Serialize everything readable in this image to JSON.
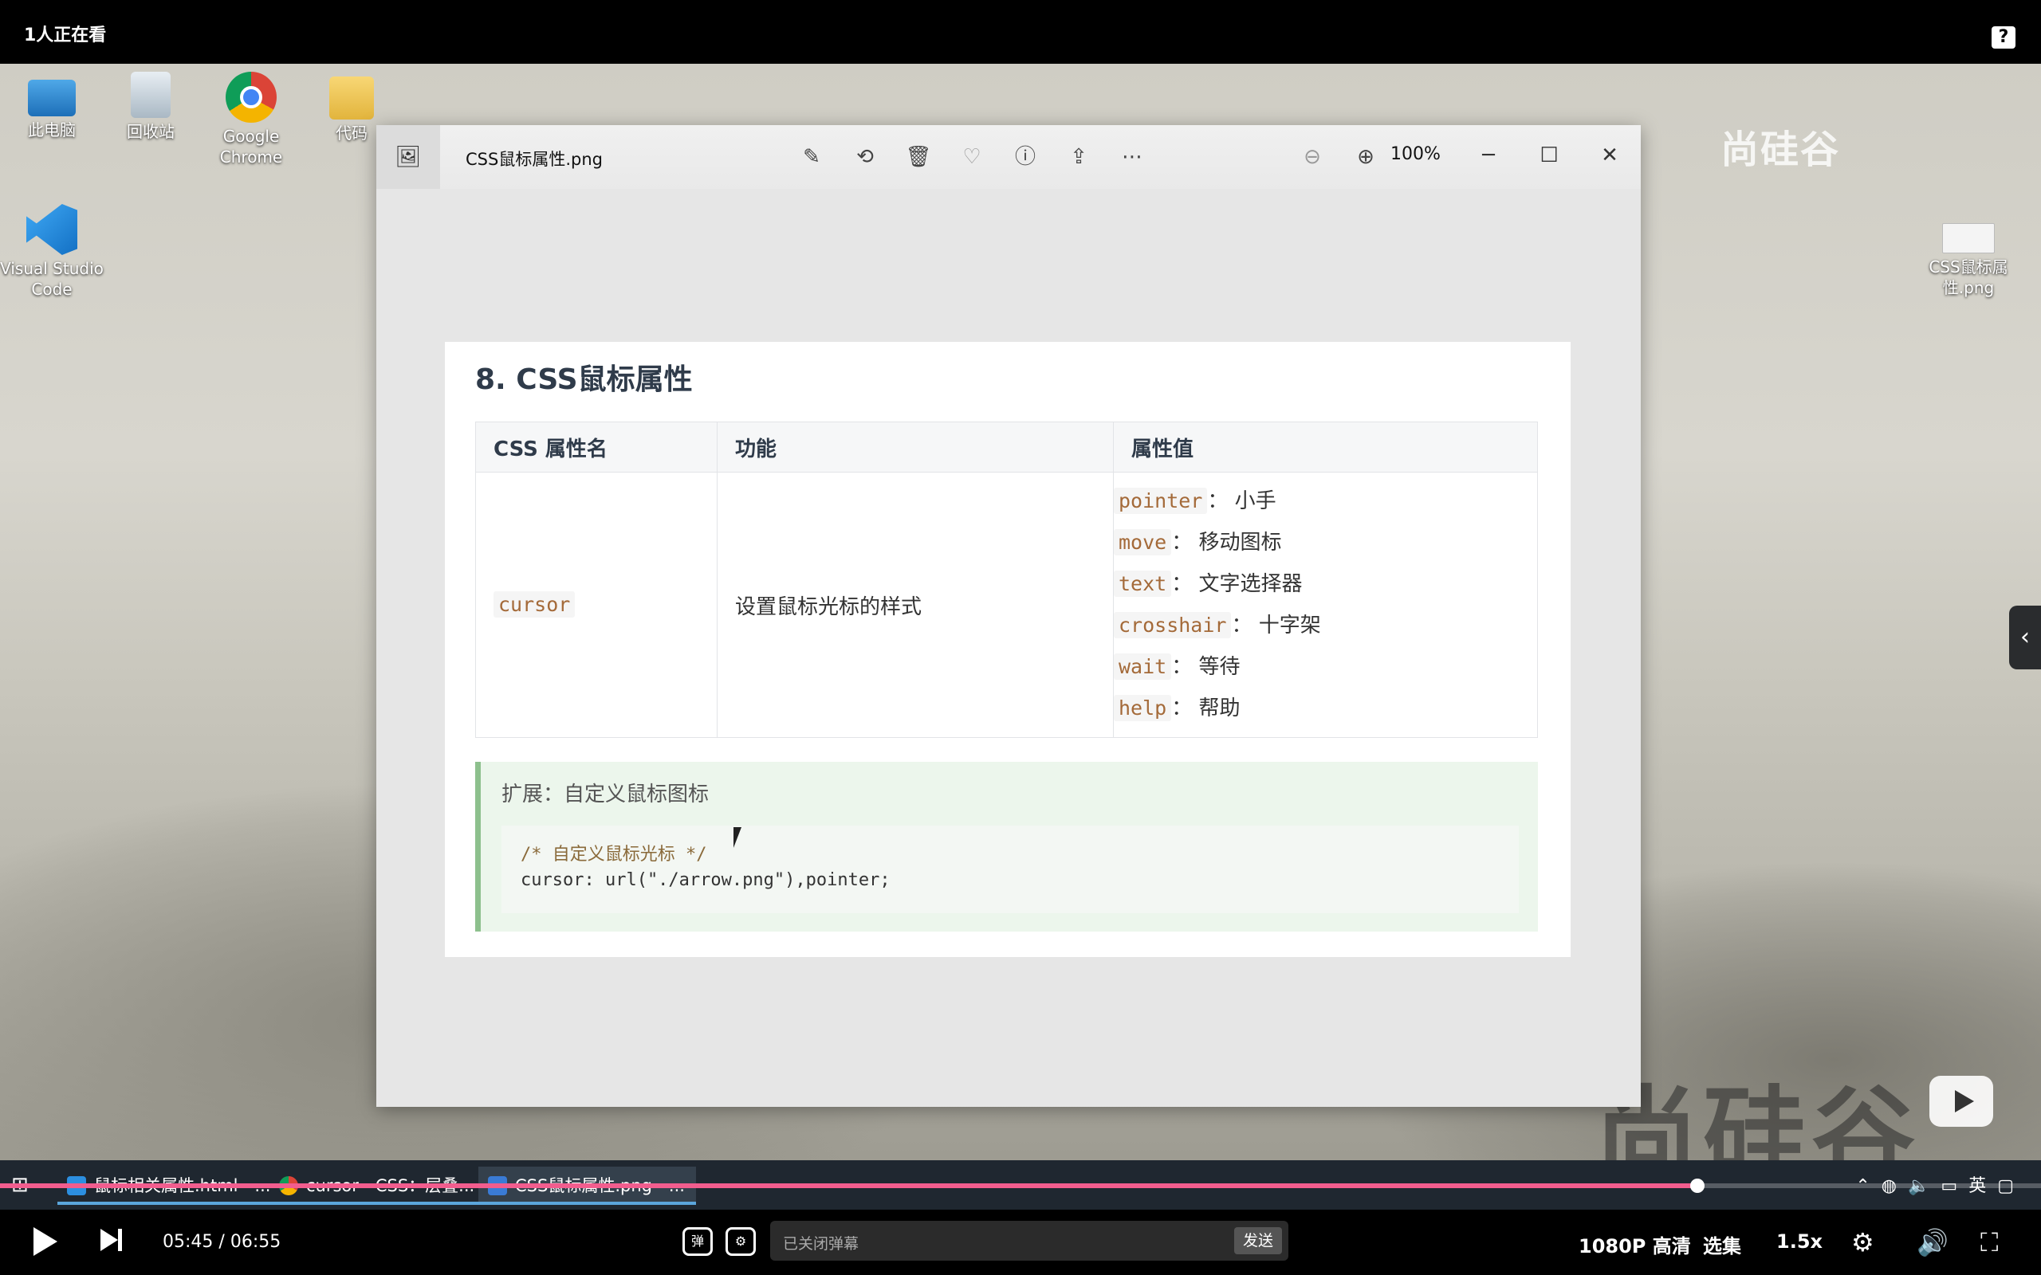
{
  "top_bar": {
    "viewers": "1人正在看",
    "help": "?"
  },
  "desktop": {
    "icons": [
      {
        "label": "此电脑"
      },
      {
        "label": "回收站"
      },
      {
        "label": "Google Chrome"
      },
      {
        "label": "代码"
      },
      {
        "label": "Visual Studio Code"
      },
      {
        "label": "CSS鼠标属性.png"
      }
    ],
    "watermark_top": "尚硅谷",
    "watermark_bottom": "尚硅谷"
  },
  "photos_window": {
    "title": "CSS鼠标属性.png",
    "zoom": "100%",
    "toolbar_icons": [
      "edit-icon",
      "rotate-icon",
      "delete-icon",
      "favorite-icon",
      "info-icon",
      "share-icon",
      "more-icon",
      "zoom-out-icon",
      "zoom-in-icon"
    ],
    "window_controls": {
      "minimize": "─",
      "maximize": "☐",
      "close": "✕"
    }
  },
  "doc": {
    "heading": "8. CSS鼠标属性",
    "table": {
      "headers": [
        "CSS 属性名",
        "功能",
        "属性值"
      ],
      "row": {
        "name": "cursor",
        "function": "设置鼠标光标的样式",
        "values": [
          {
            "code": "pointer",
            "desc": "： 小手"
          },
          {
            "code": "move",
            "desc": "： 移动图标"
          },
          {
            "code": "text",
            "desc": "： 文字选择器"
          },
          {
            "code": "crosshair",
            "desc": "： 十字架"
          },
          {
            "code": "wait",
            "desc": "： 等待"
          },
          {
            "code": "help",
            "desc": "： 帮助"
          }
        ]
      }
    },
    "extension": {
      "title": "扩展：自定义鼠标图标",
      "code_comment": "/* 自定义鼠标光标 */",
      "code_line": "cursor: url(\"./arrow.png\"),pointer;"
    }
  },
  "taskbar": {
    "items": [
      {
        "label": "鼠标相关属性.html - ..."
      },
      {
        "label": "cursor - CSS：层叠..."
      },
      {
        "label": "CSS鼠标属性.png - ..."
      }
    ],
    "tray_lang": "英"
  },
  "player": {
    "current_time": "05:45",
    "separator": "/",
    "total_time": "06:55",
    "progress": 0.8317,
    "danmu_placeholder": "已关闭弹幕",
    "send": "发送",
    "quality": "1080P 高清",
    "episodes": "选集",
    "speed": "1.5x"
  },
  "colors": {
    "progress": "#f25d8e",
    "code_text": "#a46a39",
    "accent_bar": "#8dc08d"
  }
}
